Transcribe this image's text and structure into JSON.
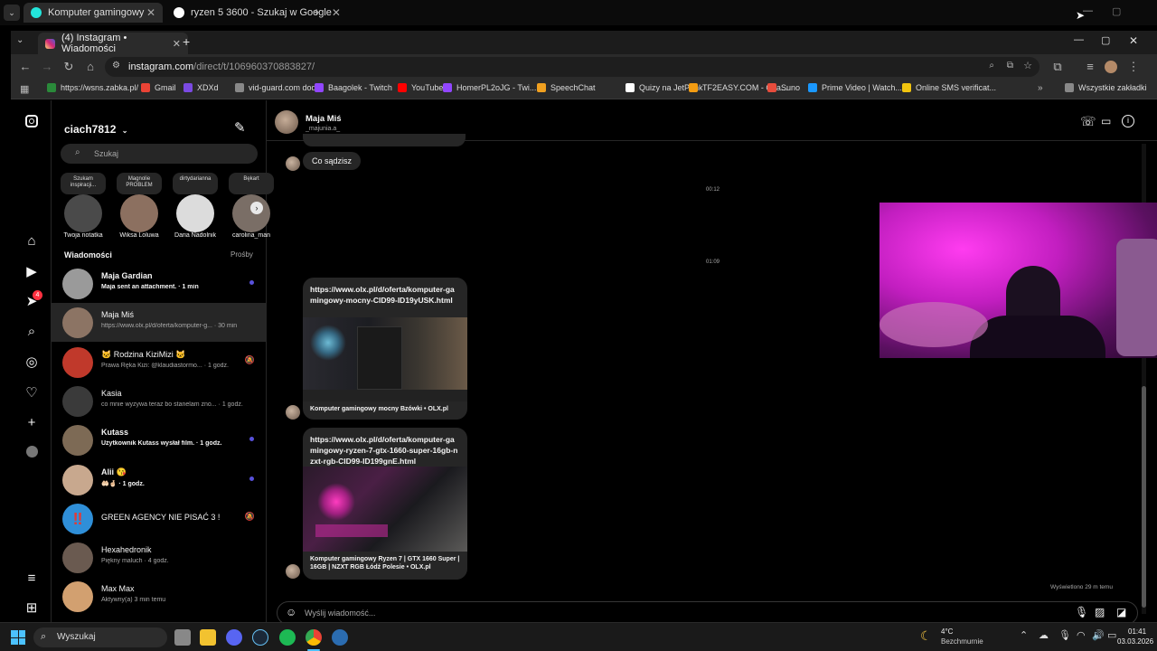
{
  "outer_tabs": [
    {
      "title": "Komputer gamingowy mocny B",
      "fav_color": "#23e5db"
    },
    {
      "title": "ryzen 5 3600 - Szukaj w Google",
      "fav_color": "#ffffff"
    }
  ],
  "inner_tab": {
    "title": "(4) Instagram • Wiadomości"
  },
  "address": {
    "domain": "instagram.com",
    "path": "/direct/t/106960370883827/"
  },
  "bookmarks": [
    {
      "label": "https://wsns.zabka.pl/",
      "color": "#2a8a3a"
    },
    {
      "label": "Gmail",
      "color": "#ea4335"
    },
    {
      "label": "XDXd",
      "color": "#7b4ae2"
    },
    {
      "label": "vid-guard.com dod...",
      "color": "#888888"
    },
    {
      "label": "Baagolek - Twitch",
      "color": "#9146ff"
    },
    {
      "label": "YouTube",
      "color": "#ff0000"
    },
    {
      "label": "HomerPL2oJG - Twi...",
      "color": "#9146ff"
    },
    {
      "label": "SpeechChat",
      "color": "#f0a020"
    },
    {
      "label": "Quizy na JetPunk",
      "color": "#ffffff"
    },
    {
      "label": "TF2EASY.COM - Cha...",
      "color": "#f39c12"
    },
    {
      "label": "Suno",
      "color": "#e74c3c"
    },
    {
      "label": "Prime Video | Watch...",
      "color": "#1a98ff"
    },
    {
      "label": "Online SMS verificat...",
      "color": "#f1c40f"
    }
  ],
  "bookmarks_all": "Wszystkie zakładki",
  "sidebar": {
    "username": "ciach7812",
    "search_placeholder": "Szukaj",
    "notification_count": "4",
    "notes": [
      {
        "bubble": "Szukam inspiracji...",
        "label": "Twoja notatka"
      },
      {
        "bubble": "Magnolie PROBLEM",
        "label": "Wiksa Loluwa"
      },
      {
        "bubble": "dirtydarianna",
        "label": "Daria Nadolnik"
      },
      {
        "bubble": "Bękart",
        "label": "carolina_man"
      }
    ],
    "messages_header": "Wiadomości",
    "requests_label": "Prośby",
    "conversations": [
      {
        "name": "Maja Gardian",
        "preview": "Maja sent an attachment. · 1 min",
        "unread": true,
        "muted": false,
        "avatar": "#9a9a9a"
      },
      {
        "name": "Maja Miś",
        "preview": "https://www.olx.pl/d/oferta/komputer-g... · 30 min",
        "unread": false,
        "muted": false,
        "avatar": "#8c7464"
      },
      {
        "name": "🐱 Rodzina KiziMizi 🐱",
        "preview": "Prawa Ręka Kizi: @klaudiastormo... · 1 godz.",
        "unread": false,
        "muted": true,
        "avatar": "#c0392b"
      },
      {
        "name": "Kasia",
        "preview": "co mnie wyzywa teraz bo stanelam zno... · 1 godz.",
        "unread": false,
        "muted": false,
        "avatar": "#3a3a3a"
      },
      {
        "name": "Kutass",
        "preview": "Użytkownik Kutass wysłał film. · 1 godz.",
        "unread": true,
        "muted": false,
        "avatar": "#7d6a55"
      },
      {
        "name": "Alii 😘",
        "preview": "🤲🏻🤞🏻 · 1 godz.",
        "unread": true,
        "muted": false,
        "avatar": "#c8a88e"
      },
      {
        "name": "GREEN AGENCY NIE PISAĆ 3 !",
        "preview": "",
        "unread": false,
        "muted": true,
        "avatar": "#2f8fd8"
      },
      {
        "name": "Hexahedronik",
        "preview": "Piękny maluch · 4 godz.",
        "unread": false,
        "muted": false,
        "avatar": "#6a5a50"
      },
      {
        "name": "Max Max",
        "preview": "Aktywny(a) 3 min temu",
        "unread": false,
        "muted": false,
        "avatar": "#d2a070"
      }
    ]
  },
  "chat": {
    "contact_name": "Maja Miś",
    "contact_handle": "_majunia.a_",
    "message1": "Co sądzisz",
    "time1": "00:12",
    "time2": "01:09",
    "links": [
      {
        "url": "https://www.olx.pl/d/oferta/komputer-gamingowy-mocny-CID99-ID19yUSK.html",
        "caption": "Komputer gamingowy mocny Bzówki • OLX.pl"
      },
      {
        "url": "https://www.olx.pl/d/oferta/komputer-gamingowy-ryzen-7-gtx-1660-super-16gb-nzxt-rgb-CID99-ID199gnE.html",
        "caption": "Komputer gamingowy Ryzen 7 | GTX 1660 Super | 16GB | NZXT RGB Łódź Polesie • OLX.pl"
      }
    ],
    "seen": "Wyświetlono 29 m temu",
    "input_placeholder": "Wyślij wiadomość..."
  },
  "taskbar": {
    "search_label": "Wyszukaj",
    "weather_temp": "4°C",
    "weather_desc": "Bezchmurnie",
    "time": "01:41",
    "date": "03.03.2026"
  }
}
